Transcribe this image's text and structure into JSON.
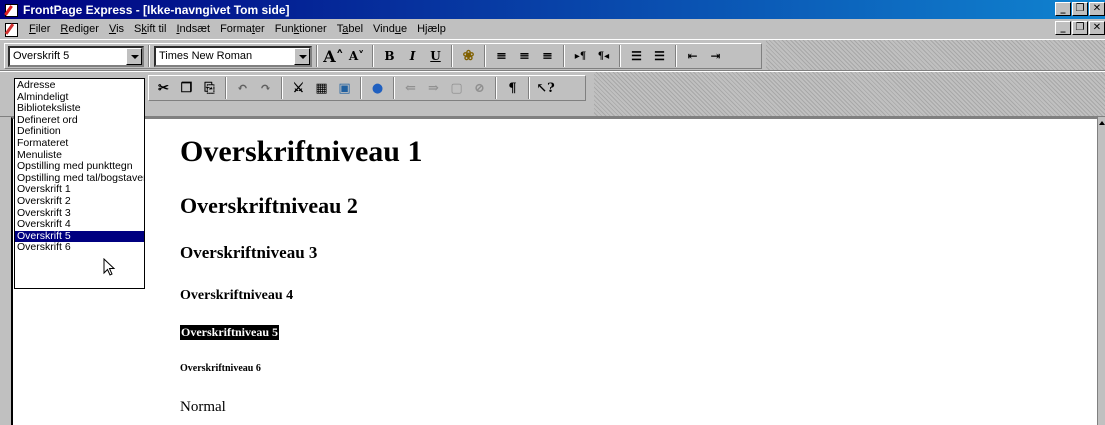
{
  "window": {
    "title": "FrontPage Express - [Ikke-navngivet Tom side]"
  },
  "menu": [
    {
      "label": "Filer",
      "key": "F"
    },
    {
      "label": "Rediger",
      "key": "R"
    },
    {
      "label": "Vis",
      "key": "V"
    },
    {
      "label": "Skift til",
      "key": "k"
    },
    {
      "label": "Indsæt",
      "key": "I"
    },
    {
      "label": "Formater",
      "key": "t"
    },
    {
      "label": "Funktioner",
      "key": "k"
    },
    {
      "label": "Tabel",
      "key": "a"
    },
    {
      "label": "Vindue",
      "key": "u"
    },
    {
      "label": "Hjælp",
      "key": "j"
    }
  ],
  "format_toolbar": {
    "style_value": "Overskrift 5",
    "font_value": "Times New Roman"
  },
  "style_dropdown": {
    "selected_index": 17,
    "options": [
      "Adresse",
      "Almindeligt",
      "Biblioteksliste",
      "Defineret ord",
      "Definition",
      "Formateret",
      "Menuliste",
      "Opstilling med punkttegn",
      "Opstilling med tal/bogstaver",
      "Overskrift 1",
      "Overskrift 2",
      "Overskrift 3",
      "Overskrift 4",
      "Overskrift 5",
      "Overskrift 6"
    ]
  },
  "document": {
    "h1": "Overskriftniveau 1",
    "h2": "Overskriftniveau 2",
    "h3": "Overskriftniveau 3",
    "h4": "Overskriftniveau 4",
    "h5": "Overskriftniveau 5",
    "h6": "Overskriftniveau 6",
    "normal": "Normal"
  }
}
